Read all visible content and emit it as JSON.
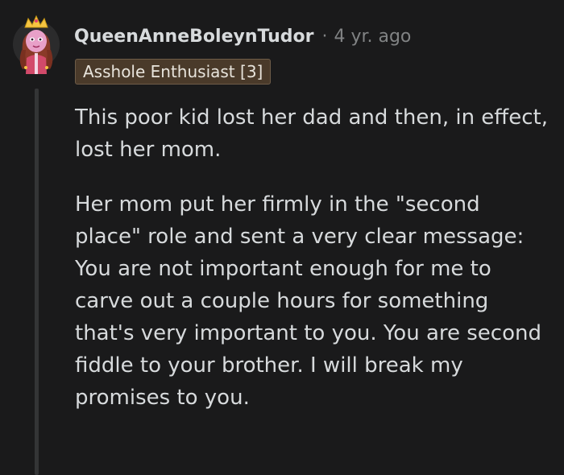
{
  "comment": {
    "author": {
      "username": "QueenAnneBoleynTudor",
      "avatar_icon": "princess-avatar-icon"
    },
    "separator": "·",
    "timestamp": "4 yr. ago",
    "flair": "Asshole Enthusiast [3]",
    "paragraphs": [
      "This poor kid lost her dad and then, in effect, lost her mom.",
      "Her mom put her firmly in the \"second place\" role and sent a very clear message: You are not important enough for me to carve out a couple hours for something that's very important to you. You are second fiddle to your brother. I will break my promises to you."
    ]
  },
  "colors": {
    "background": "#1a1a1b",
    "text": "#d7dadc",
    "muted": "#818384",
    "thread_line": "#343536",
    "flair_bg": "#4a3a2a"
  }
}
